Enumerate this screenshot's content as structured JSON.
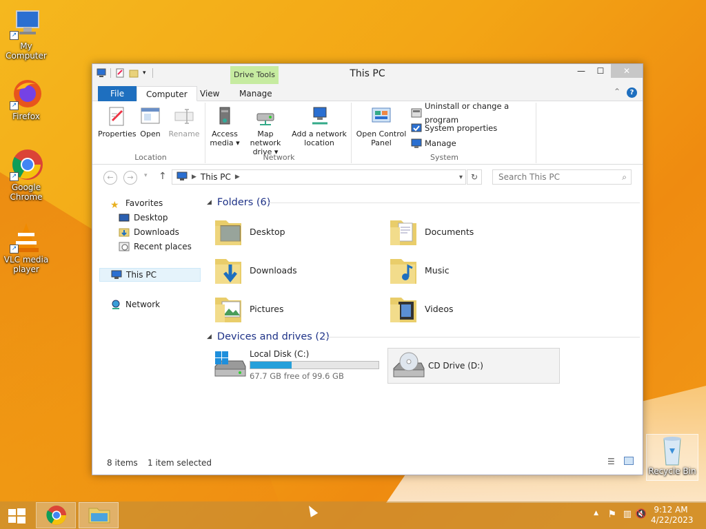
{
  "desktop": {
    "icons": [
      {
        "label": "My Computer"
      },
      {
        "label": "Firefox"
      },
      {
        "label": "Google Chrome"
      },
      {
        "label": "VLC media player"
      },
      {
        "label": "Recycle Bin"
      }
    ]
  },
  "window": {
    "title": "This PC",
    "contextual_tab": "Drive Tools",
    "controls": {
      "minimize": "—",
      "maximize": "☐",
      "close": "✕"
    },
    "tabs": [
      "File",
      "Computer",
      "View",
      "Manage"
    ],
    "active_tab": "Computer",
    "ribbon": {
      "location": {
        "name": "Location",
        "properties": "Properties",
        "open": "Open",
        "rename": "Rename"
      },
      "network": {
        "name": "Network",
        "access_media": "Access media ▾",
        "map_drive": "Map network drive ▾",
        "add_location": "Add a network location"
      },
      "system": {
        "name": "System",
        "open_cp": "Open Control Panel",
        "uninstall": "Uninstall or change a program",
        "sys_props": "System properties",
        "manage": "Manage"
      }
    },
    "address": {
      "crumb": "This PC",
      "search_placeholder": "Search This PC"
    },
    "nav_pane": {
      "favorites": "Favorites",
      "desktop": "Desktop",
      "downloads": "Downloads",
      "recent": "Recent places",
      "this_pc": "This PC",
      "network": "Network"
    },
    "folders_header": "Folders (6)",
    "folders": [
      "Desktop",
      "Documents",
      "Downloads",
      "Music",
      "Pictures",
      "Videos"
    ],
    "drives_header": "Devices and drives (2)",
    "drives": {
      "c": {
        "name": "Local Disk (C:)",
        "free": "67.7 GB free of 99.6 GB",
        "used_fraction": 0.32
      },
      "d": {
        "name": "CD Drive (D:)"
      }
    },
    "status": {
      "items": "8 items",
      "selected": "1 item selected"
    }
  },
  "taskbar": {
    "time": "9:12 AM",
    "date": "4/22/2023"
  },
  "colors": {
    "accent": "#1e6fbf",
    "selection": "#e5f3fb",
    "drive_bar": "#26a0da",
    "header_text": "#1e3287"
  }
}
